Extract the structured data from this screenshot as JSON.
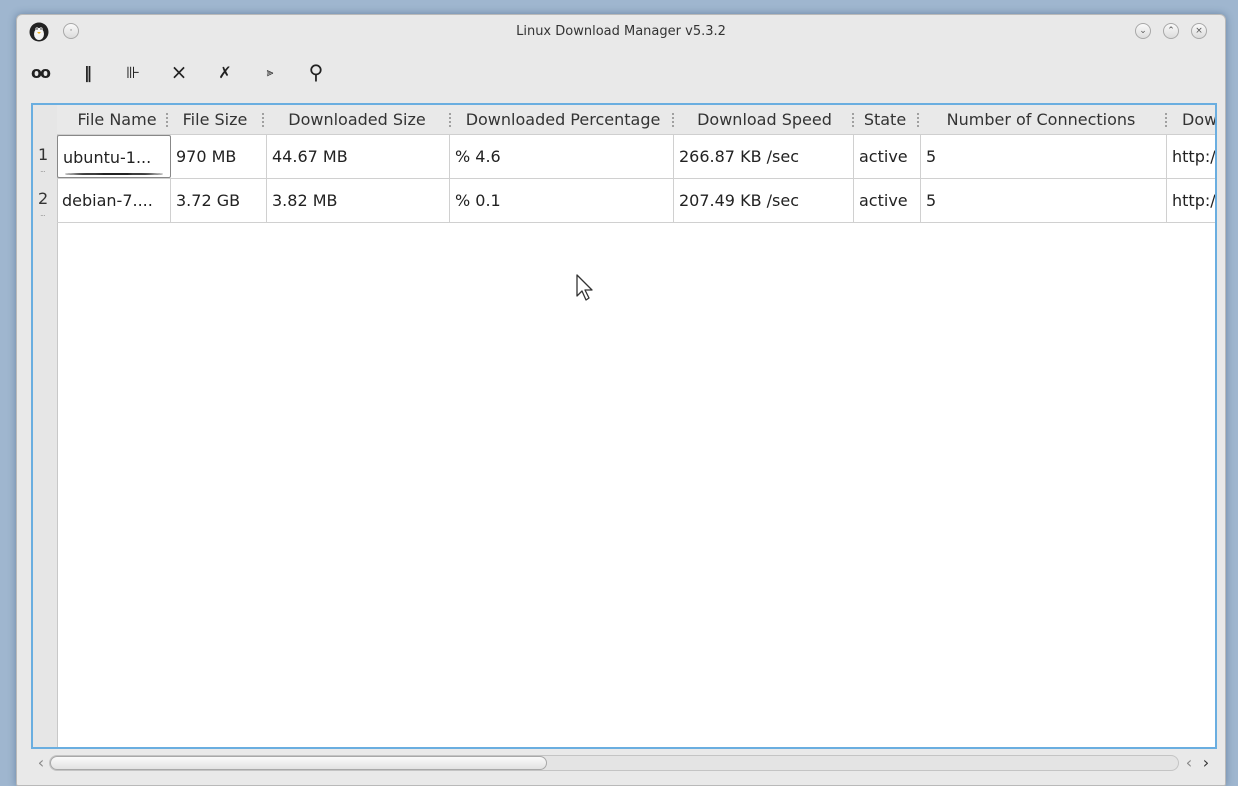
{
  "window": {
    "title": "Linux Download Manager v5.3.2",
    "controls": {
      "minimize": "⌄",
      "maximize": "⌃",
      "close": "×"
    }
  },
  "toolbar": {
    "items": [
      {
        "icon": "add-link-icon",
        "glyph": "oo"
      },
      {
        "icon": "pause-icon",
        "glyph": "‖"
      },
      {
        "icon": "resume-icon",
        "glyph": "⊪"
      },
      {
        "icon": "remove-icon",
        "glyph": "×"
      },
      {
        "icon": "remove-completed-icon",
        "glyph": "✗"
      },
      {
        "icon": "properties-icon",
        "glyph": "⫸"
      },
      {
        "icon": "search-icon",
        "glyph": "⚲"
      }
    ]
  },
  "table": {
    "columns": [
      "File Name",
      "File Size",
      "Downloaded Size",
      "Downloaded Percentage",
      "Download Speed",
      "State",
      "Number of Connections",
      "Dow"
    ],
    "rows": [
      {
        "num": "1",
        "cells": [
          "ubuntu-1...",
          "970 MB",
          "44.67 MB",
          "% 4.6",
          "266.87 KB /sec",
          "active",
          "5",
          "http:/"
        ]
      },
      {
        "num": "2",
        "cells": [
          "debian-7....",
          "3.72 GB",
          "3.82 MB",
          "% 0.1",
          "207.49 KB /sec",
          "active",
          "5",
          "http:/"
        ]
      }
    ],
    "row_dots": "..."
  },
  "scrollbar": {
    "left_arrow": "‹",
    "right_arrow": "›"
  },
  "colors": {
    "accent": "#6aaee0"
  }
}
